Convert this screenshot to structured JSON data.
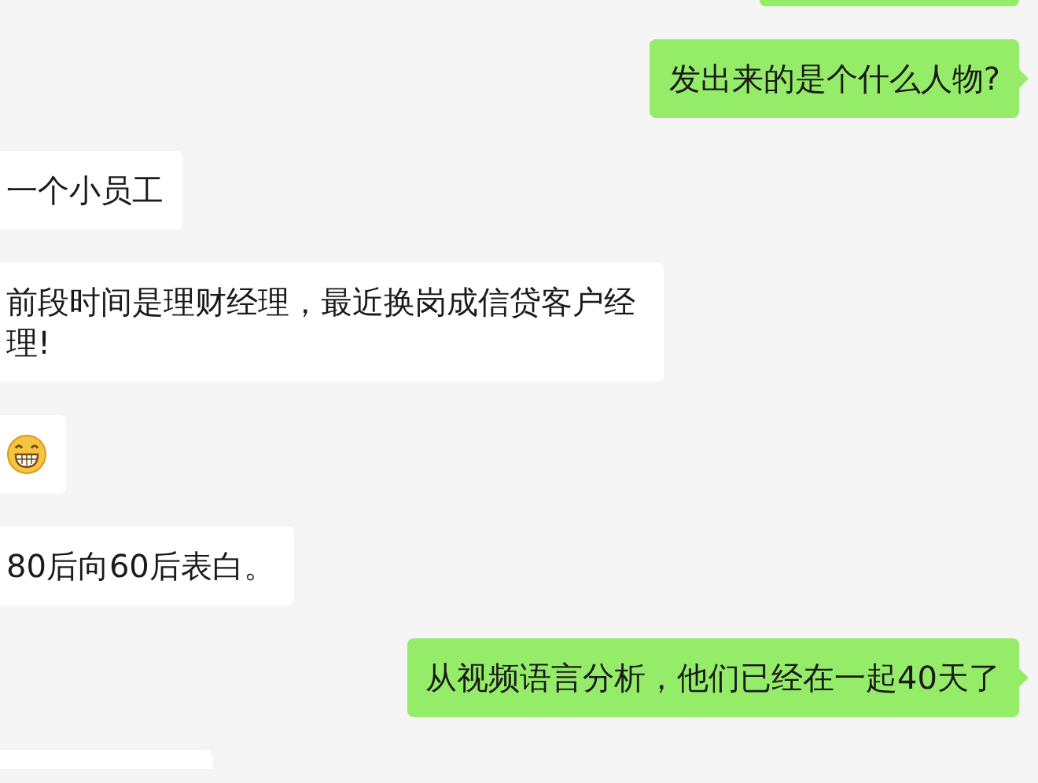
{
  "messages": [
    {
      "outgoing": true,
      "kind": "clipped"
    },
    {
      "outgoing": true,
      "kind": "text",
      "text": "发出来的是个什么人物?"
    },
    {
      "outgoing": false,
      "kind": "text",
      "text": "一个小员工"
    },
    {
      "outgoing": false,
      "kind": "text",
      "text": "前段时间是理财经理，最近换岗成信贷客户经理!"
    },
    {
      "outgoing": false,
      "kind": "emoji"
    },
    {
      "outgoing": false,
      "kind": "text",
      "text": "80后向60后表白。"
    },
    {
      "outgoing": true,
      "kind": "text",
      "text": "从视频语言分析，他们已经在一起40天了"
    },
    {
      "outgoing": false,
      "kind": "clipped"
    }
  ]
}
